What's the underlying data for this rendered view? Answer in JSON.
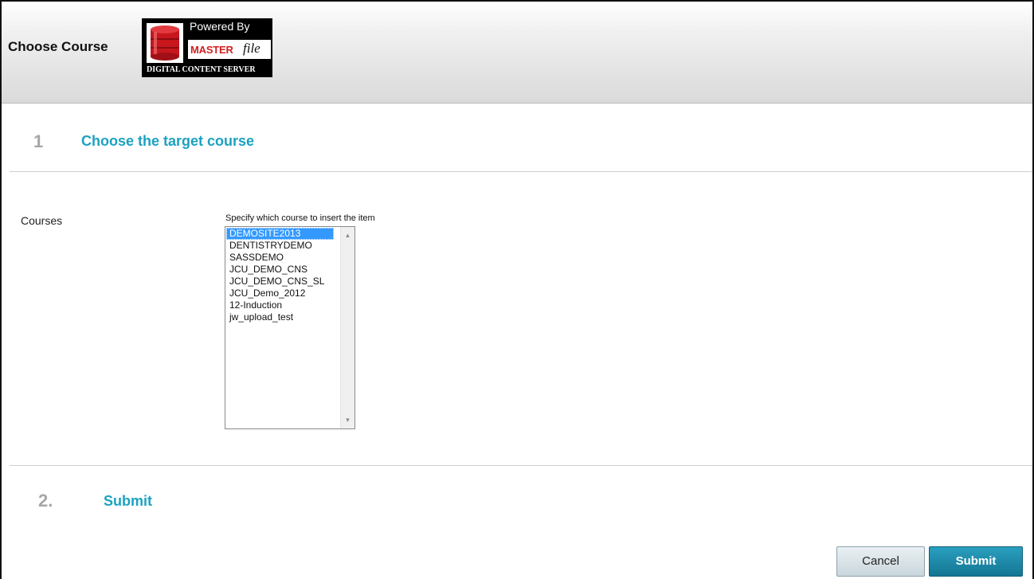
{
  "header": {
    "title": "Choose Course",
    "logo": {
      "powered_by": "Powered By",
      "brand_master": "MASTER",
      "brand_file": "file",
      "tagline": "DIGITAL CONTENT SERVER"
    }
  },
  "step1": {
    "number": "1",
    "title": "Choose the target course"
  },
  "courses": {
    "label": "Courses",
    "hint": "Specify which course to insert the item",
    "selected": "DEMOSITE2013",
    "items": [
      "DEMOSITE2013",
      "DENTISTRYDEMO",
      "SASSDEMO",
      "JCU_DEMO_CNS",
      "JCU_DEMO_CNS_SL",
      "JCU_Demo_2012",
      "12-Induction",
      "jw_upload_test"
    ]
  },
  "step2": {
    "number": "2.",
    "title": "Submit"
  },
  "buttons": {
    "cancel": "Cancel",
    "submit": "Submit"
  },
  "colors": {
    "accent": "#1ba2c0",
    "selection": "#3399ff",
    "submit_bg": "#1a89a9"
  }
}
